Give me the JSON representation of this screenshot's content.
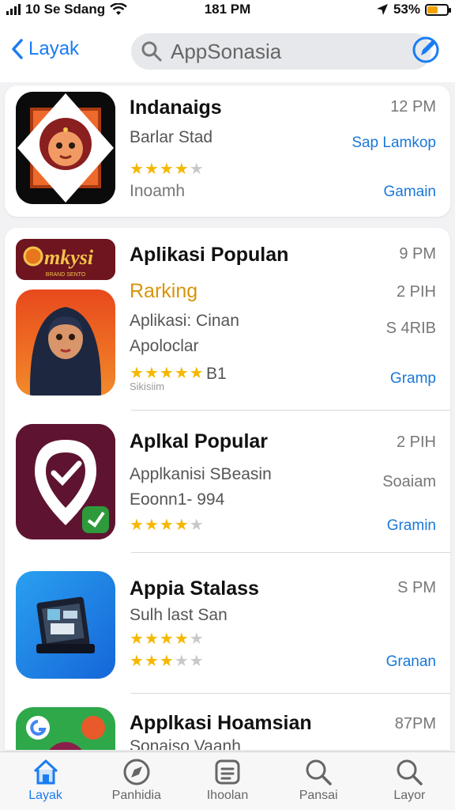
{
  "status": {
    "carrier": "10 Se Sdang",
    "time": "181 PM",
    "battery": "53%",
    "battery_level": 0.53
  },
  "nav": {
    "back_label": "Layak",
    "search_placeholder": "AppSonasia"
  },
  "apps": [
    {
      "title": "Indanaigs",
      "subtitle": "Barlar Stad",
      "detail": "Inoamh",
      "time": "12 PM",
      "link": "Sap Lamkop",
      "action": "Gamain",
      "rating": 4
    },
    {
      "banner": "mkysi",
      "banner_sub": "BRAND SENTO",
      "title": "Aplikasi Populan",
      "rank": "Rarking",
      "subtitle": "Aplikasi: Cinan",
      "subtitle2": "Apoloclar",
      "rating_text": "B1",
      "rating_sub": "Sikisiim",
      "time": "9 PM",
      "time2": "2 PIH",
      "meta": "S 4RIB",
      "action": "Gramp",
      "rating": 5
    },
    {
      "title": "Aplkal Popular",
      "subtitle": "Applkanisi SBeasin",
      "subtitle2": "Eoonn1- 994",
      "time": "2 PIH",
      "meta": "Soaiam",
      "action": "Gramin",
      "rating": 4
    },
    {
      "title": "Appia Stalass",
      "subtitle": "Sulh last San",
      "time": "S PM",
      "action": "Granan",
      "rating": 4,
      "rating2": 3
    },
    {
      "title": "Applkasi Hoamsian",
      "subtitle": "Sonaiso Vaanh",
      "time": "87PM"
    }
  ],
  "tabs": [
    {
      "label": "Layak",
      "icon": "home-icon"
    },
    {
      "label": "Panhidia",
      "icon": "compass-icon"
    },
    {
      "label": "Ihoolan",
      "icon": "document-icon"
    },
    {
      "label": "Pansai",
      "icon": "search-icon"
    },
    {
      "label": "Layor",
      "icon": "search-icon"
    }
  ],
  "colors": {
    "accent": "#1a7cf2",
    "star": "#f5b800",
    "rank": "#d89408"
  }
}
